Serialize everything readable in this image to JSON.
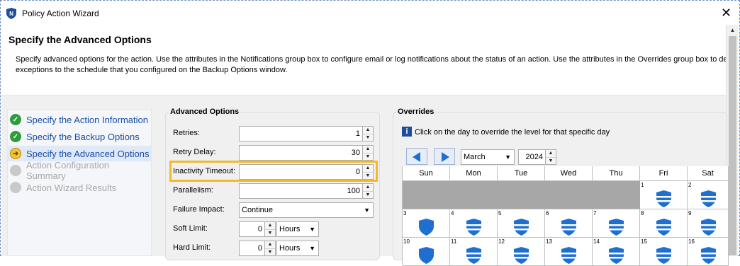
{
  "window": {
    "title": "Policy Action Wizard",
    "close_icon": "✕"
  },
  "header": {
    "title": "Specify the Advanced Options",
    "description_line1": "Specify advanced options for the action. Use the attributes in the Notifications group box to configure email or log notifications about the status of an action. Use the attributes in the Overrides group box to defi",
    "description_line2": "exceptions to the schedule that you configured on the Backup Options window."
  },
  "steps": [
    {
      "label": "Specify the Action Information",
      "state": "done"
    },
    {
      "label": "Specify the Backup Options",
      "state": "done"
    },
    {
      "label": "Specify the Advanced Options",
      "state": "current"
    },
    {
      "label": "Action Configuration Summary",
      "state": "pending"
    },
    {
      "label": "Action Wizard Results",
      "state": "pending"
    }
  ],
  "advanced": {
    "group_title": "Advanced Options",
    "retries_label": "Retries:",
    "retries_value": "1",
    "retry_delay_label": "Retry Delay:",
    "retry_delay_value": "30",
    "inactivity_label": "Inactivity Timeout:",
    "inactivity_value": "0",
    "parallelism_label": "Parallelism:",
    "parallelism_value": "100",
    "failure_impact_label": "Failure Impact:",
    "failure_impact_value": "Continue",
    "soft_limit_label": "Soft Limit:",
    "soft_limit_value": "0",
    "soft_limit_unit": "Hours",
    "hard_limit_label": "Hard Limit:",
    "hard_limit_value": "0",
    "hard_limit_unit": "Hours"
  },
  "overrides": {
    "group_title": "Overrides",
    "hint_icon": "i",
    "hint": "Click on the day to override the level for that specific day",
    "month": "March",
    "year": "2024",
    "days_of_week": [
      "Sun",
      "Mon",
      "Tue",
      "Wed",
      "Thu",
      "Fri",
      "Sat"
    ],
    "row1": [
      "",
      "",
      "",
      "",
      "",
      "1",
      "2"
    ],
    "row2": [
      "3",
      "4",
      "5",
      "6",
      "7",
      "8",
      "9"
    ],
    "row3": [
      "10",
      "11",
      "12",
      "13",
      "14",
      "15",
      "16"
    ]
  },
  "colors": {
    "accent": "#1f6fd1",
    "highlight": "#f2b92b",
    "done": "#2e9c3a",
    "link": "#1a4ea8"
  }
}
